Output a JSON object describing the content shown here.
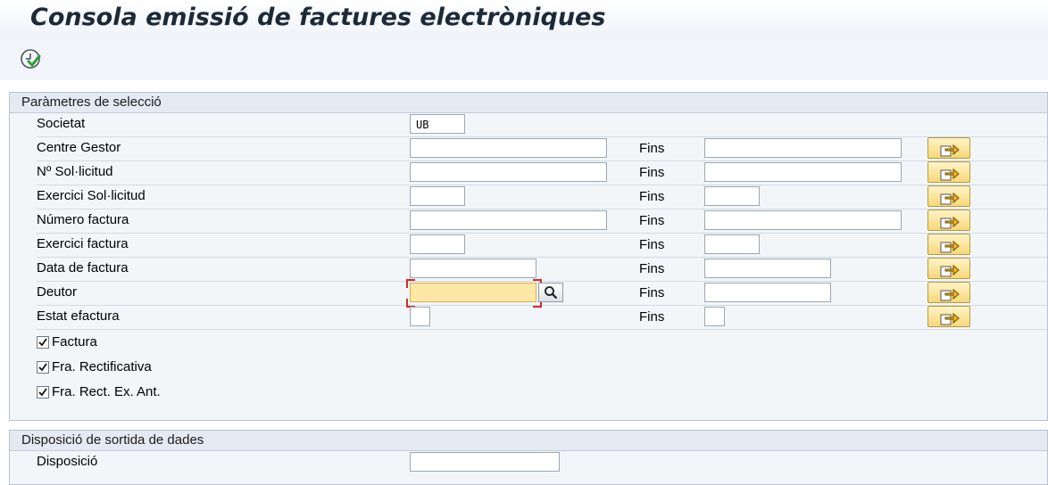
{
  "window": {
    "title": "Consola emissió de factures electròniques"
  },
  "toolbar": {
    "execute_icon": "execute-clock-icon"
  },
  "selection": {
    "header": "Paràmetres de selecció",
    "fins_label": "Fins",
    "rows": [
      {
        "label": "Societat",
        "value": "UB"
      },
      {
        "label": "Centre Gestor",
        "value": ""
      },
      {
        "label": "Nº Sol·licitud",
        "value": ""
      },
      {
        "label": "Exercici Sol·licitud",
        "value": ""
      },
      {
        "label": "Número factura",
        "value": ""
      },
      {
        "label": "Exercici factura",
        "value": ""
      },
      {
        "label": "Data de factura",
        "value": ""
      },
      {
        "label": "Deutor",
        "value": ""
      },
      {
        "label": "Estat efactura",
        "value": ""
      }
    ],
    "checkboxes": [
      {
        "label": "Factura",
        "checked": true
      },
      {
        "label": "Fra. Rectificativa",
        "checked": true
      },
      {
        "label": "Fra. Rect. Ex. Ant.",
        "checked": true
      }
    ]
  },
  "output": {
    "header": "Disposició de sortida de dades",
    "layout_label": "Disposició",
    "layout_value": ""
  },
  "colors": {
    "focus_field": "#fde8a6",
    "button_yellow": "#f6d879",
    "group_bg": "#f3f6f9"
  }
}
